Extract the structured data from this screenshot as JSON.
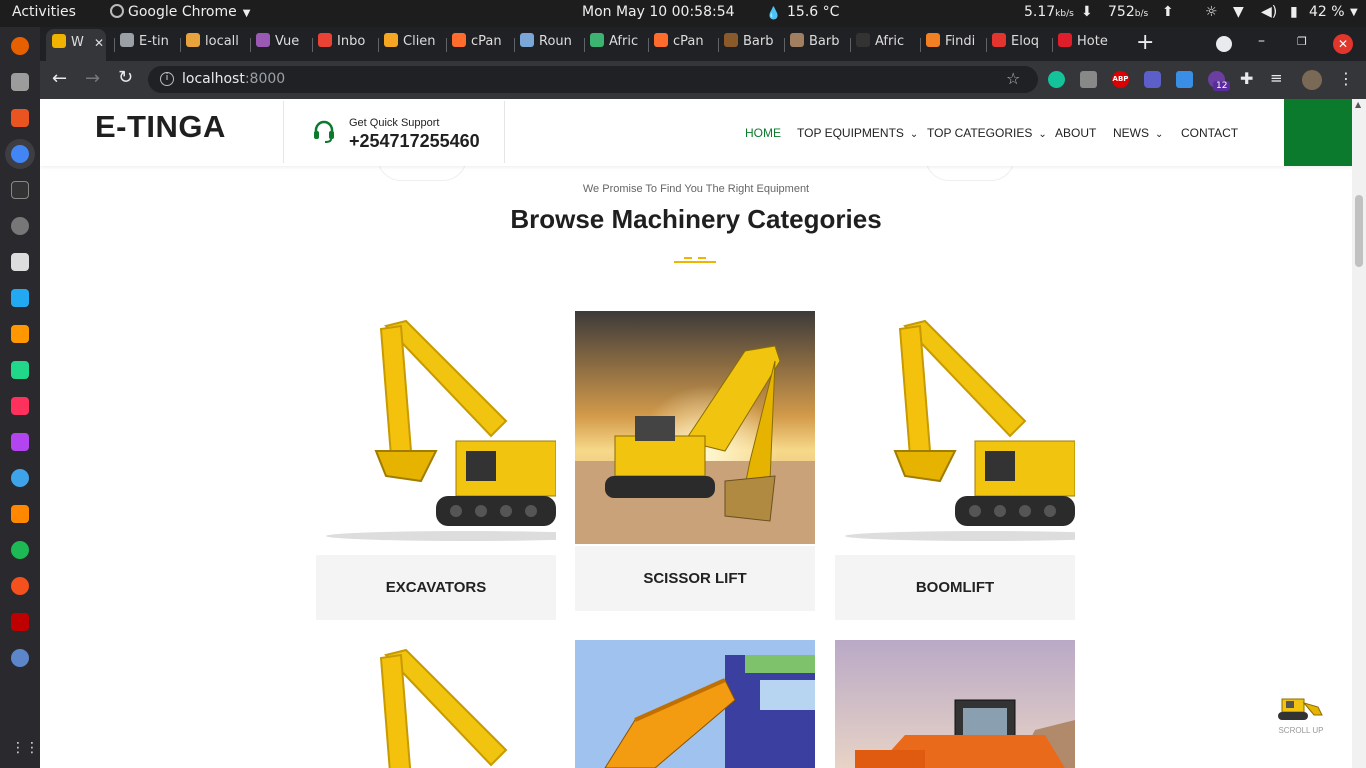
{
  "os": {
    "activities": "Activities",
    "app_name": "Google Chrome",
    "clock": "Mon May 10  00:58:54",
    "weather": "15.6 °C",
    "net_down": "5.17",
    "net_down_unit": "kb/s",
    "net_up": "752",
    "net_up_unit": "b/s",
    "battery": "42 %"
  },
  "browser": {
    "tabs": [
      {
        "label": "W",
        "color": "#f0b400"
      },
      {
        "label": "E-tin",
        "color": "#9aa0a6"
      },
      {
        "label": "locall",
        "color": "#e8a33d"
      },
      {
        "label": "Vue",
        "color": "#9b59b6"
      },
      {
        "label": "Inbo",
        "color": "#ea4335"
      },
      {
        "label": "Clien",
        "color": "#f5a623"
      },
      {
        "label": "cPan",
        "color": "#ff6c2c"
      },
      {
        "label": "Roun",
        "color": "#7aa7d8"
      },
      {
        "label": "Afric",
        "color": "#3cb371"
      },
      {
        "label": "cPan",
        "color": "#ff6c2c"
      },
      {
        "label": "Barb",
        "color": "#8b5a2b"
      },
      {
        "label": "Barb",
        "color": "#a08060"
      },
      {
        "label": "Afric",
        "color": "#333333"
      },
      {
        "label": "Findi",
        "color": "#f48024"
      },
      {
        "label": "Eloq",
        "color": "#e3342f"
      },
      {
        "label": "Hote",
        "color": "#e01e2b"
      }
    ],
    "url_host": "localhost",
    "url_port": ":8000",
    "ext_badge": "12",
    "ext_abp": "ABP"
  },
  "site": {
    "logo": "E-TINGA",
    "support_label": "Get Quick Support",
    "support_phone": "+254717255460",
    "nav": {
      "home": "HOME",
      "top_equipments": "TOP EQUIPMENTS",
      "top_categories": "TOP CATEGORIES",
      "about": "ABOUT",
      "news": "NEWS",
      "contact": "CONTACT"
    },
    "colors": {
      "accent_green": "#0b7a2c",
      "accent_yellow": "#f0b400"
    },
    "section": {
      "subtitle": "We Promise To Find You The Right Equipment",
      "title": "Browse Machinery Categories"
    },
    "categories": [
      {
        "label": "EXCAVATORS"
      },
      {
        "label": "SCISSOR LIFT"
      },
      {
        "label": "BOOMLIFT"
      }
    ],
    "scroll_up": "SCROLL UP"
  }
}
